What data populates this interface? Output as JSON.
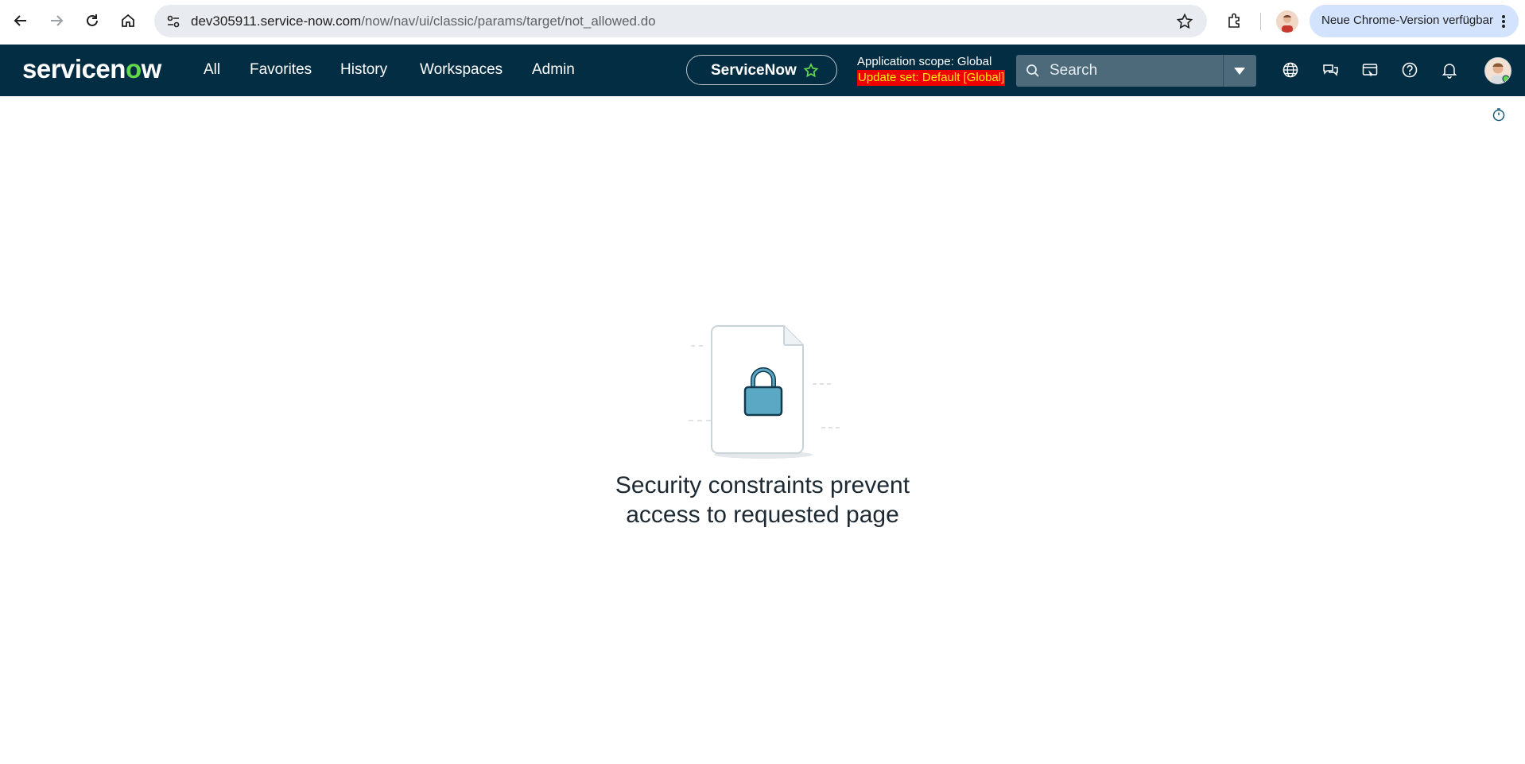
{
  "browser": {
    "url_host": "dev305911.service-now.com",
    "url_path": "/now/nav/ui/classic/params/target/not_allowed.do",
    "update_label": "Neue Chrome-Version verfügbar"
  },
  "header": {
    "logo": {
      "prefix": "servicen",
      "o": "o",
      "suffix": "w"
    },
    "menu": [
      "All",
      "Favorites",
      "History",
      "Workspaces",
      "Admin"
    ],
    "instance_label": "ServiceNow",
    "scope": "Application scope: Global",
    "update_set": "Update set: Default [Global]",
    "search_placeholder": "Search"
  },
  "main": {
    "message_line1": "Security constraints prevent",
    "message_line2": "access to requested page"
  },
  "colors": {
    "header_bg": "#032d42",
    "brand_green": "#62d84e",
    "update_set_bg": "#ee0000",
    "update_set_text": "#ffee00",
    "lock": "#5aa8c4"
  },
  "icons": [
    "back-icon",
    "forward-icon",
    "reload-icon",
    "home-icon",
    "site-info-icon",
    "bookmark-star-icon",
    "extensions-icon",
    "profile-icon",
    "more-icon",
    "favorite-star-icon",
    "search-icon",
    "dropdown-icon",
    "globe-icon",
    "chat-icon",
    "screen-icon",
    "help-icon",
    "bell-icon",
    "avatar",
    "timer-icon",
    "lock-icon"
  ]
}
